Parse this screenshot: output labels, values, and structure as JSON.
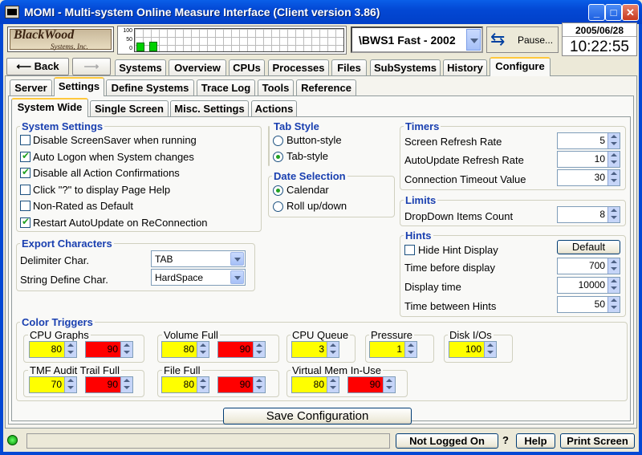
{
  "window": {
    "title": "MOMI - Multi-system Online Measure Interface (Client version 3.86)"
  },
  "logo": {
    "name": "BlackWood",
    "sub": "Systems, Inc."
  },
  "graph": {
    "scale": [
      "100",
      "50",
      "0"
    ],
    "levels": [
      0.35,
      0.4
    ]
  },
  "system": {
    "selected": "\\BWS1 Fast - 2002"
  },
  "pause": {
    "label": "Pause..."
  },
  "clock": {
    "date": "2005/06/28",
    "time": "10:22:55"
  },
  "nav": {
    "back": "Back",
    "tabs": [
      "Systems",
      "Overview",
      "CPUs",
      "Processes",
      "Files",
      "SubSystems",
      "History",
      "Configure"
    ]
  },
  "subtabs": [
    "Server",
    "Settings",
    "Define Systems",
    "Trace Log",
    "Tools",
    "Reference"
  ],
  "subsubtabs": [
    "System Wide",
    "Single Screen",
    "Misc. Settings",
    "Actions"
  ],
  "system_settings": {
    "title": "System Settings",
    "items": [
      {
        "label": "Disable ScreenSaver when running",
        "checked": false
      },
      {
        "label": "Auto Logon when System changes",
        "checked": true
      },
      {
        "label": "Disable all Action Confirmations",
        "checked": true
      },
      {
        "label": "Click \"?\" to display Page Help",
        "checked": false
      },
      {
        "label": "Non-Rated as Default",
        "checked": false
      },
      {
        "label": "Restart AutoUpdate on ReConnection",
        "checked": true
      }
    ]
  },
  "tab_style": {
    "title": "Tab Style",
    "options": [
      "Button-style",
      "Tab-style"
    ],
    "selected": 1
  },
  "date_selection": {
    "title": "Date Selection",
    "options": [
      "Calendar",
      "Roll up/down"
    ],
    "selected": 0
  },
  "timers": {
    "title": "Timers",
    "items": [
      {
        "label": "Screen Refresh Rate",
        "value": "5"
      },
      {
        "label": "AutoUpdate Refresh Rate",
        "value": "10"
      },
      {
        "label": "Connection Timeout Value",
        "value": "30"
      }
    ]
  },
  "limits": {
    "title": "Limits",
    "label": "DropDown Items Count",
    "value": "8"
  },
  "hints": {
    "title": "Hints",
    "hide_label": "Hide Hint Display",
    "hide_checked": false,
    "default_button": "Default",
    "items": [
      {
        "label": "Time before display",
        "value": "700"
      },
      {
        "label": "Display time",
        "value": "10000"
      },
      {
        "label": "Time between Hints",
        "value": "50"
      }
    ]
  },
  "export": {
    "title": "Export Characters",
    "delimiter_label": "Delimiter Char.",
    "delimiter_value": "TAB",
    "string_label": "String Define Char.",
    "string_value": "HardSpace"
  },
  "color_triggers": {
    "title": "Color Triggers",
    "groups": [
      {
        "label": "CPU Graphs",
        "yellow": "80",
        "red": "90"
      },
      {
        "label": "Volume Full",
        "yellow": "80",
        "red": "90"
      },
      {
        "label": "CPU Queue",
        "yellow": "3"
      },
      {
        "label": "Pressure",
        "yellow": "1"
      },
      {
        "label": "Disk I/Os",
        "yellow": "100"
      },
      {
        "label": "TMF Audit Trail Full",
        "yellow": "70",
        "red": "90"
      },
      {
        "label": "File Full",
        "yellow": "80",
        "red": "90"
      },
      {
        "label": "Virtual Mem In-Use",
        "yellow": "80",
        "red": "90"
      }
    ]
  },
  "save_button": "Save Configuration",
  "status": {
    "login": "Not Logged On",
    "question": "?",
    "help": "Help",
    "print": "Print Screen"
  },
  "colors": {
    "titlebar": "#0348d4",
    "group_title": "#1a40b0",
    "trigger_warn": "#ffff00",
    "trigger_crit": "#ff0000"
  }
}
